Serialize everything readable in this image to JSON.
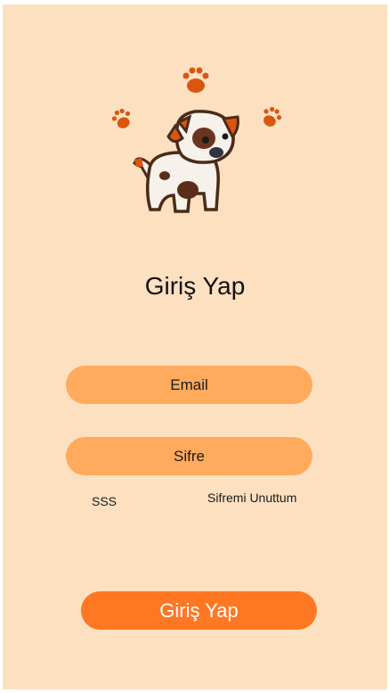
{
  "login": {
    "title": "Giriş Yap",
    "email_placeholder": "Email",
    "password_placeholder": "Sifre",
    "faq_link": "SSS",
    "forgot_link": "Sifremi Unuttum",
    "submit_label": "Giriş Yap"
  },
  "colors": {
    "background": "#fde0c0",
    "field": "#ffaa5c",
    "button": "#ff7722",
    "paw": "#d9560f"
  },
  "icons": [
    "paw-icon",
    "dog-logo"
  ]
}
